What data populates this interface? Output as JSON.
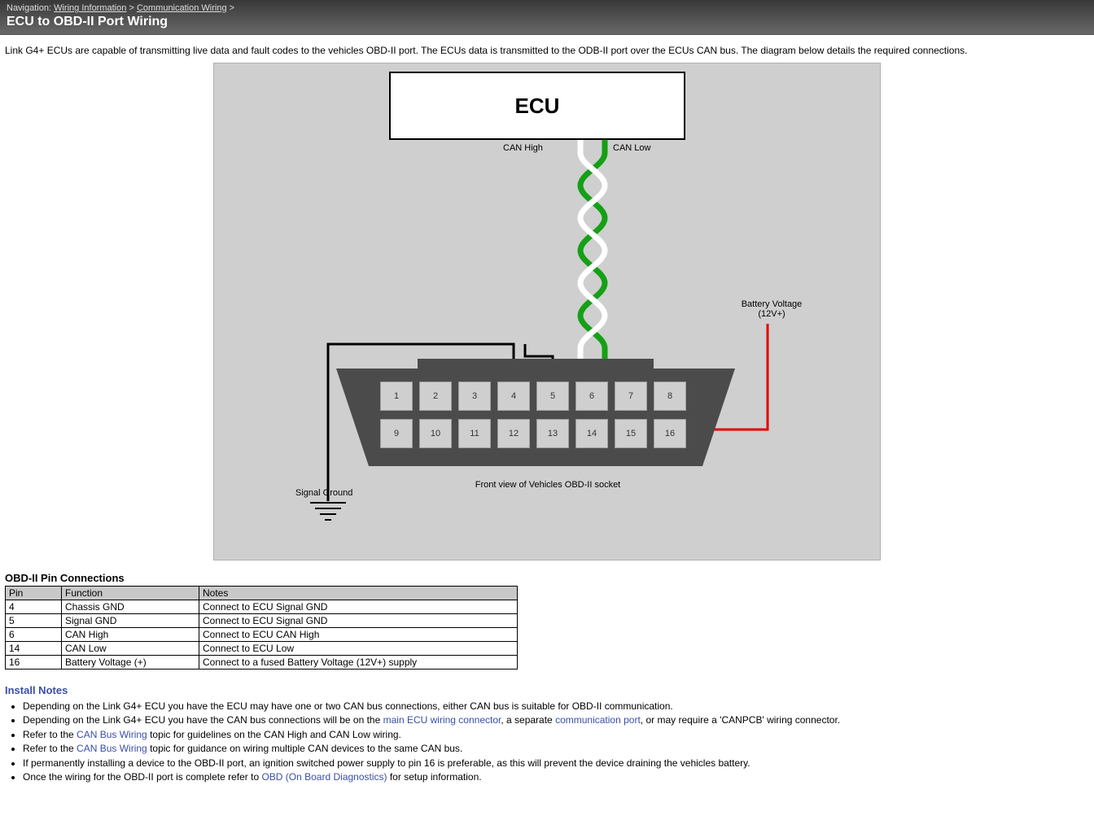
{
  "nav": {
    "label": "Navigation:",
    "crumb1": "Wiring Information",
    "crumb2": "Communication Wiring",
    "sep": ">",
    "title": "ECU to OBD-II Port Wiring"
  },
  "intro": "Link G4+ ECUs are capable of transmitting live data and fault codes to the vehicles OBD-II port. The ECUs data is transmitted to the ODB-II port over the ECUs CAN bus. The diagram below details the required connections.",
  "diagram": {
    "ecu_label": "ECU",
    "can_high": "CAN High",
    "can_low": "CAN Low",
    "battery_voltage": "Battery Voltage",
    "battery_voltage2": "(12V+)",
    "signal_ground": "Signal Ground",
    "connector_caption": "Front view of Vehicles OBD-II socket",
    "pins": [
      "1",
      "2",
      "3",
      "4",
      "5",
      "6",
      "7",
      "8",
      "9",
      "10",
      "11",
      "12",
      "13",
      "14",
      "15",
      "16"
    ]
  },
  "table": {
    "heading": "OBD-II Pin Connections",
    "headers": [
      "Pin",
      "Function",
      "Notes"
    ],
    "rows": [
      {
        "pin": "4",
        "func": "Chassis GND",
        "note": "Connect to ECU Signal GND"
      },
      {
        "pin": "5",
        "func": "Signal GND",
        "note": "Connect to ECU Signal GND"
      },
      {
        "pin": "6",
        "func": "CAN High",
        "note": "Connect to ECU CAN High"
      },
      {
        "pin": "14",
        "func": "CAN Low",
        "note": "Connect to ECU Low"
      },
      {
        "pin": "16",
        "func": "Battery Voltage (+)",
        "note": "Connect to a fused Battery Voltage (12V+) supply"
      }
    ]
  },
  "install": {
    "heading": "Install Notes",
    "notes": [
      {
        "pre": "Depending on the Link G4+ ECU you have the ECU may have one or two CAN bus connections, either CAN bus is suitable for OBD-II communication.",
        "links": []
      },
      {
        "pre": "Depending on the Link G4+ ECU you have the CAN bus connections will be on the ",
        "link1": "main ECU wiring connector",
        "mid": ", a separate ",
        "link2": "communication port",
        "post": ", or may require a 'CANPCB' wiring connector."
      },
      {
        "pre": "Refer to the ",
        "link1": "CAN Bus Wiring",
        "post": " topic for guidelines on the CAN High and CAN Low wiring."
      },
      {
        "pre": "Refer to the ",
        "link1": "CAN Bus Wiring",
        "post": " topic for guidance on wiring multiple CAN devices to the same CAN bus."
      },
      {
        "pre": "If permanently installing a device to the OBD-II port, an ignition switched power supply to pin 16 is preferable, as this will prevent the device draining the vehicles battery."
      },
      {
        "pre": "Once the wiring for the OBD-II port is complete refer to ",
        "link1": "OBD (On Board Diagnostics)",
        "post": " for setup information."
      }
    ]
  }
}
